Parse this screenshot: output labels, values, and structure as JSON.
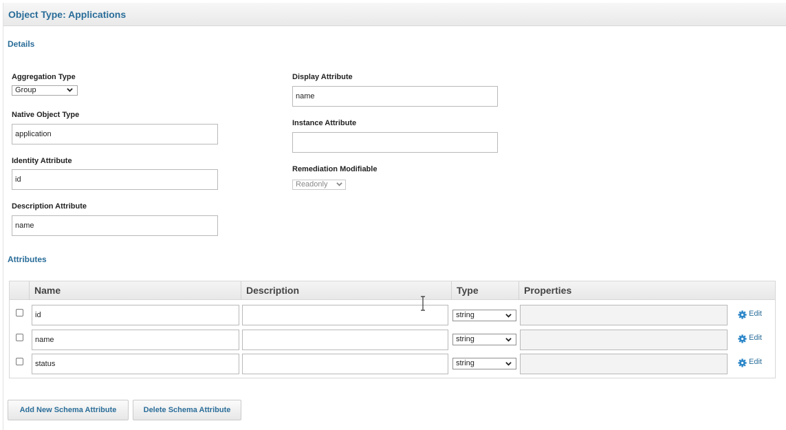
{
  "header": {
    "title": "Object Type: Applications"
  },
  "details": {
    "heading": "Details",
    "aggregation_type": {
      "label": "Aggregation Type",
      "value": "Group"
    },
    "native_object_type": {
      "label": "Native Object Type",
      "value": "application"
    },
    "identity_attribute": {
      "label": "Identity Attribute",
      "value": "id"
    },
    "description_attribute": {
      "label": "Description Attribute",
      "value": "name"
    },
    "display_attribute": {
      "label": "Display Attribute",
      "value": "name"
    },
    "instance_attribute": {
      "label": "Instance Attribute",
      "value": ""
    },
    "remediation_modifiable": {
      "label": "Remediation Modifiable",
      "value": "Readonly"
    }
  },
  "attributes": {
    "heading": "Attributes",
    "columns": [
      "Name",
      "Description",
      "Type",
      "Properties"
    ],
    "rows": [
      {
        "name": "id",
        "description": "",
        "type": "string",
        "properties": "",
        "edit": "Edit"
      },
      {
        "name": "name",
        "description": "",
        "type": "string",
        "properties": "",
        "edit": "Edit"
      },
      {
        "name": "status",
        "description": "",
        "type": "string",
        "properties": "",
        "edit": "Edit"
      }
    ]
  },
  "buttons": {
    "add": "Add New Schema Attribute",
    "delete": "Delete Schema Attribute"
  },
  "icons": {
    "gear": "gear-icon",
    "chevron": "chevron-down-icon",
    "cursor": "text-cursor-icon"
  },
  "colors": {
    "accent": "#2a6d99",
    "gear": "#2b86c9"
  }
}
